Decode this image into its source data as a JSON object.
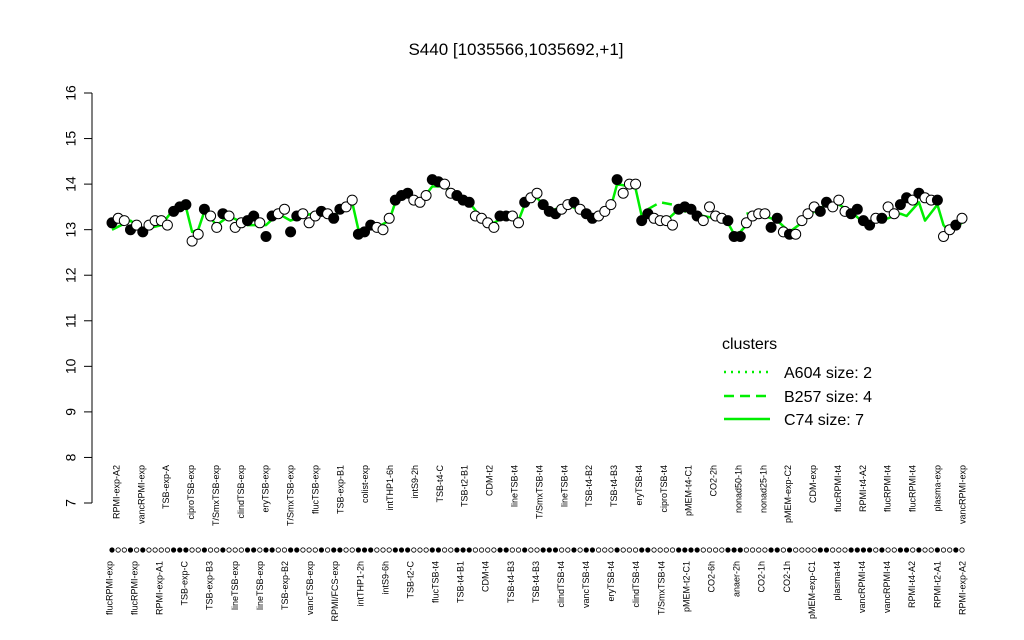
{
  "chart_data": {
    "type": "scatter",
    "title": "S440 [1035566,1035692,+1]",
    "xlabel": "",
    "ylabel": "",
    "ylim": [
      7,
      16
    ],
    "yticks": [
      7,
      8,
      9,
      10,
      11,
      12,
      13,
      14,
      15,
      16
    ],
    "grid": false,
    "line_color": "#00ee00",
    "legend": {
      "title": "clusters",
      "position": "right",
      "entries": [
        {
          "label": "A604 size: 2",
          "style": "dotted"
        },
        {
          "label": "B257 size: 4",
          "style": "dashed"
        },
        {
          "label": "C74 size: 7",
          "style": "solid"
        }
      ]
    },
    "top_labels": [
      "RPMI-exp-A2",
      "vancRPMI-exp",
      "TSB-exp-A",
      "ciproTSB-exp",
      "T/SmxTSB-exp",
      "clindTSB-exp",
      "eryTSB-exp",
      "T/SmxTSB-exp",
      "flucTSB-exp",
      "TSB-exp-B1",
      "colist-exp",
      "intTHP1-6h",
      "intS9-2h",
      "TSB-t4-C",
      "TSB-t2-B1",
      "CDM-t2",
      "lineTSB-t4",
      "T/SmxTSB-t4",
      "lineTSB-t4",
      "TSB-t4-B2",
      "TSB-t4-B3",
      "eryTSB-t4",
      "ciproTSB-t4",
      "pMEM-t4-C1",
      "CO2-2h",
      "nonad50-1h",
      "nonad25-1h",
      "pMEM-exp-C2",
      "CDM-exp",
      "flucRPMI-t4",
      "RPMI-t4-A2",
      "flucRPMI-t4",
      "flucRPMI-t4",
      "plasma-exp",
      "vancRPMI-exp"
    ],
    "bottom_labels": [
      "flucRPMI-exp",
      "flucRPMI-exp",
      "RPMI-exp-A1",
      "TSB-exp-C",
      "TSB-exp-B3",
      "lineTSB-exp",
      "lineTSB-exp",
      "TSB-exp-B2",
      "vancTSB-exp",
      "RPMI/FCS-exp",
      "intTHP1-2h",
      "intS9-6h",
      "TSB-t2-C",
      "flucTSB-t4",
      "TSB-t4-B1",
      "CDM-t4",
      "TSB-t4-B3",
      "TSB-t4-B3",
      "clindTSB-t4",
      "vancTSB-t4",
      "eryTSB-t4",
      "clindTSB-t4",
      "T/SmxTSB-t4",
      "pMEM-t2-C1",
      "CO2-6h",
      "anaer-2h",
      "CO2-1h",
      "CO2-1h",
      "pMEM-exp-C1",
      "plasma-t4",
      "vancRPMI-t4",
      "vancRPMI-t4",
      "RPMI-t4-A2",
      "RPMI-t2-A1",
      "RPMI-exp-A2"
    ],
    "points": [
      {
        "x": 1,
        "y": 13.15,
        "f": 1
      },
      {
        "x": 2,
        "y": 13.25,
        "f": 0
      },
      {
        "x": 3,
        "y": 13.2,
        "f": 0
      },
      {
        "x": 4,
        "y": 13.0,
        "f": 1
      },
      {
        "x": 5,
        "y": 13.1,
        "f": 0
      },
      {
        "x": 6,
        "y": 12.95,
        "f": 1
      },
      {
        "x": 7,
        "y": 13.1,
        "f": 0
      },
      {
        "x": 8,
        "y": 13.2,
        "f": 0
      },
      {
        "x": 9,
        "y": 13.2,
        "f": 0
      },
      {
        "x": 10,
        "y": 13.1,
        "f": 0
      },
      {
        "x": 11,
        "y": 13.4,
        "f": 1
      },
      {
        "x": 12,
        "y": 13.5,
        "f": 1
      },
      {
        "x": 13,
        "y": 13.55,
        "f": 1
      },
      {
        "x": 14,
        "y": 12.75,
        "f": 0
      },
      {
        "x": 15,
        "y": 12.9,
        "f": 0
      },
      {
        "x": 16,
        "y": 13.45,
        "f": 1
      },
      {
        "x": 17,
        "y": 13.3,
        "f": 0
      },
      {
        "x": 18,
        "y": 13.05,
        "f": 0
      },
      {
        "x": 19,
        "y": 13.35,
        "f": 1
      },
      {
        "x": 20,
        "y": 13.3,
        "f": 0
      },
      {
        "x": 21,
        "y": 13.05,
        "f": 0
      },
      {
        "x": 22,
        "y": 13.15,
        "f": 0
      },
      {
        "x": 23,
        "y": 13.2,
        "f": 1
      },
      {
        "x": 24,
        "y": 13.3,
        "f": 1
      },
      {
        "x": 25,
        "y": 13.15,
        "f": 0
      },
      {
        "x": 26,
        "y": 12.85,
        "f": 1
      },
      {
        "x": 27,
        "y": 13.3,
        "f": 1
      },
      {
        "x": 28,
        "y": 13.35,
        "f": 0
      },
      {
        "x": 29,
        "y": 13.45,
        "f": 0
      },
      {
        "x": 30,
        "y": 12.95,
        "f": 1
      },
      {
        "x": 31,
        "y": 13.3,
        "f": 1
      },
      {
        "x": 32,
        "y": 13.35,
        "f": 0
      },
      {
        "x": 33,
        "y": 13.15,
        "f": 0
      },
      {
        "x": 34,
        "y": 13.3,
        "f": 0
      },
      {
        "x": 35,
        "y": 13.4,
        "f": 1
      },
      {
        "x": 36,
        "y": 13.35,
        "f": 0
      },
      {
        "x": 37,
        "y": 13.25,
        "f": 1
      },
      {
        "x": 38,
        "y": 13.45,
        "f": 1
      },
      {
        "x": 39,
        "y": 13.5,
        "f": 0
      },
      {
        "x": 40,
        "y": 13.65,
        "f": 0
      },
      {
        "x": 41,
        "y": 12.9,
        "f": 1
      },
      {
        "x": 42,
        "y": 12.95,
        "f": 1
      },
      {
        "x": 43,
        "y": 13.1,
        "f": 1
      },
      {
        "x": 44,
        "y": 13.05,
        "f": 0
      },
      {
        "x": 45,
        "y": 13.0,
        "f": 0
      },
      {
        "x": 46,
        "y": 13.25,
        "f": 0
      },
      {
        "x": 47,
        "y": 13.65,
        "f": 1
      },
      {
        "x": 48,
        "y": 13.75,
        "f": 1
      },
      {
        "x": 49,
        "y": 13.8,
        "f": 1
      },
      {
        "x": 50,
        "y": 13.65,
        "f": 0
      },
      {
        "x": 51,
        "y": 13.6,
        "f": 0
      },
      {
        "x": 52,
        "y": 13.75,
        "f": 0
      },
      {
        "x": 53,
        "y": 14.1,
        "f": 1
      },
      {
        "x": 54,
        "y": 14.05,
        "f": 1
      },
      {
        "x": 55,
        "y": 14.0,
        "f": 0
      },
      {
        "x": 56,
        "y": 13.8,
        "f": 0
      },
      {
        "x": 57,
        "y": 13.75,
        "f": 1
      },
      {
        "x": 58,
        "y": 13.65,
        "f": 1
      },
      {
        "x": 59,
        "y": 13.6,
        "f": 1
      },
      {
        "x": 60,
        "y": 13.3,
        "f": 0
      },
      {
        "x": 61,
        "y": 13.25,
        "f": 0
      },
      {
        "x": 62,
        "y": 13.15,
        "f": 0
      },
      {
        "x": 63,
        "y": 13.05,
        "f": 0
      },
      {
        "x": 64,
        "y": 13.3,
        "f": 1
      },
      {
        "x": 65,
        "y": 13.3,
        "f": 1
      },
      {
        "x": 66,
        "y": 13.3,
        "f": 0
      },
      {
        "x": 67,
        "y": 13.15,
        "f": 0
      },
      {
        "x": 68,
        "y": 13.6,
        "f": 1
      },
      {
        "x": 69,
        "y": 13.7,
        "f": 0
      },
      {
        "x": 70,
        "y": 13.8,
        "f": 0
      },
      {
        "x": 71,
        "y": 13.55,
        "f": 1
      },
      {
        "x": 72,
        "y": 13.4,
        "f": 1
      },
      {
        "x": 73,
        "y": 13.35,
        "f": 1
      },
      {
        "x": 74,
        "y": 13.45,
        "f": 0
      },
      {
        "x": 75,
        "y": 13.55,
        "f": 0
      },
      {
        "x": 76,
        "y": 13.6,
        "f": 1
      },
      {
        "x": 77,
        "y": 13.45,
        "f": 0
      },
      {
        "x": 78,
        "y": 13.35,
        "f": 1
      },
      {
        "x": 79,
        "y": 13.25,
        "f": 1
      },
      {
        "x": 80,
        "y": 13.3,
        "f": 0
      },
      {
        "x": 81,
        "y": 13.4,
        "f": 0
      },
      {
        "x": 82,
        "y": 13.55,
        "f": 0
      },
      {
        "x": 83,
        "y": 14.1,
        "f": 1
      },
      {
        "x": 84,
        "y": 13.8,
        "f": 0
      },
      {
        "x": 85,
        "y": 14.0,
        "f": 0
      },
      {
        "x": 86,
        "y": 14.0,
        "f": 0
      },
      {
        "x": 87,
        "y": 13.2,
        "f": 1
      },
      {
        "x": 88,
        "y": 13.35,
        "f": 1
      },
      {
        "x": 89,
        "y": 13.25,
        "f": 0
      },
      {
        "x": 90,
        "y": 13.2,
        "f": 0
      },
      {
        "x": 91,
        "y": 13.2,
        "f": 0
      },
      {
        "x": 92,
        "y": 13.1,
        "f": 0
      },
      {
        "x": 93,
        "y": 13.45,
        "f": 1
      },
      {
        "x": 94,
        "y": 13.5,
        "f": 1
      },
      {
        "x": 95,
        "y": 13.45,
        "f": 1
      },
      {
        "x": 96,
        "y": 13.3,
        "f": 1
      },
      {
        "x": 97,
        "y": 13.2,
        "f": 0
      },
      {
        "x": 98,
        "y": 13.5,
        "f": 0
      },
      {
        "x": 99,
        "y": 13.3,
        "f": 0
      },
      {
        "x": 100,
        "y": 13.25,
        "f": 0
      },
      {
        "x": 101,
        "y": 13.2,
        "f": 1
      },
      {
        "x": 102,
        "y": 12.85,
        "f": 1
      },
      {
        "x": 103,
        "y": 12.85,
        "f": 1
      },
      {
        "x": 104,
        "y": 13.15,
        "f": 0
      },
      {
        "x": 105,
        "y": 13.3,
        "f": 0
      },
      {
        "x": 106,
        "y": 13.35,
        "f": 0
      },
      {
        "x": 107,
        "y": 13.35,
        "f": 0
      },
      {
        "x": 108,
        "y": 13.05,
        "f": 1
      },
      {
        "x": 109,
        "y": 13.25,
        "f": 1
      },
      {
        "x": 110,
        "y": 12.95,
        "f": 0
      },
      {
        "x": 111,
        "y": 12.9,
        "f": 1
      },
      {
        "x": 112,
        "y": 12.9,
        "f": 0
      },
      {
        "x": 113,
        "y": 13.2,
        "f": 0
      },
      {
        "x": 114,
        "y": 13.35,
        "f": 0
      },
      {
        "x": 115,
        "y": 13.5,
        "f": 0
      },
      {
        "x": 116,
        "y": 13.4,
        "f": 1
      },
      {
        "x": 117,
        "y": 13.6,
        "f": 1
      },
      {
        "x": 118,
        "y": 13.5,
        "f": 0
      },
      {
        "x": 119,
        "y": 13.65,
        "f": 0
      },
      {
        "x": 120,
        "y": 13.4,
        "f": 0
      },
      {
        "x": 121,
        "y": 13.35,
        "f": 1
      },
      {
        "x": 122,
        "y": 13.45,
        "f": 1
      },
      {
        "x": 123,
        "y": 13.2,
        "f": 1
      },
      {
        "x": 124,
        "y": 13.1,
        "f": 1
      },
      {
        "x": 125,
        "y": 13.25,
        "f": 0
      },
      {
        "x": 126,
        "y": 13.25,
        "f": 1
      },
      {
        "x": 127,
        "y": 13.5,
        "f": 0
      },
      {
        "x": 128,
        "y": 13.35,
        "f": 0
      },
      {
        "x": 129,
        "y": 13.55,
        "f": 1
      },
      {
        "x": 130,
        "y": 13.7,
        "f": 1
      },
      {
        "x": 131,
        "y": 13.65,
        "f": 0
      },
      {
        "x": 132,
        "y": 13.8,
        "f": 1
      },
      {
        "x": 133,
        "y": 13.7,
        "f": 0
      },
      {
        "x": 134,
        "y": 13.65,
        "f": 0
      },
      {
        "x": 135,
        "y": 13.65,
        "f": 1
      },
      {
        "x": 136,
        "y": 12.85,
        "f": 0
      },
      {
        "x": 137,
        "y": 13.0,
        "f": 0
      },
      {
        "x": 138,
        "y": 13.1,
        "f": 1
      },
      {
        "x": 139,
        "y": 13.25,
        "f": 0
      }
    ],
    "line_solid": [
      [
        1,
        13.0
      ],
      [
        4,
        13.2
      ],
      [
        6,
        13.0
      ],
      [
        9,
        13.1
      ],
      [
        11,
        13.45
      ],
      [
        13,
        13.5
      ],
      [
        14,
        12.95
      ],
      [
        15,
        13.0
      ],
      [
        16,
        13.4
      ],
      [
        18,
        13.1
      ],
      [
        20,
        13.3
      ],
      [
        23,
        13.1
      ],
      [
        26,
        13.1
      ],
      [
        28,
        13.35
      ],
      [
        30,
        13.2
      ],
      [
        32,
        13.3
      ],
      [
        35,
        13.4
      ],
      [
        37,
        13.3
      ],
      [
        40,
        13.6
      ],
      [
        41,
        13.0
      ],
      [
        44,
        13.05
      ],
      [
        46,
        13.2
      ],
      [
        47,
        13.6
      ],
      [
        49,
        13.75
      ],
      [
        51,
        13.6
      ],
      [
        53,
        13.95
      ],
      [
        55,
        13.95
      ],
      [
        57,
        13.7
      ],
      [
        59,
        13.6
      ],
      [
        61,
        13.25
      ],
      [
        63,
        13.15
      ],
      [
        65,
        13.3
      ],
      [
        67,
        13.2
      ],
      [
        68,
        13.55
      ],
      [
        70,
        13.7
      ],
      [
        72,
        13.4
      ],
      [
        75,
        13.55
      ],
      [
        78,
        13.35
      ],
      [
        80,
        13.3
      ],
      [
        82,
        13.5
      ],
      [
        83,
        14.0
      ],
      [
        85,
        13.95
      ],
      [
        86,
        13.9
      ],
      [
        87,
        13.3
      ],
      [
        89,
        13.25
      ],
      [
        91,
        13.2
      ],
      [
        93,
        13.45
      ],
      [
        95,
        13.4
      ],
      [
        97,
        13.3
      ],
      [
        99,
        13.25
      ],
      [
        101,
        13.15
      ],
      [
        102,
        12.9
      ],
      [
        103,
        12.95
      ],
      [
        105,
        13.25
      ],
      [
        107,
        13.3
      ],
      [
        109,
        13.2
      ],
      [
        111,
        12.95
      ],
      [
        113,
        13.15
      ],
      [
        115,
        13.4
      ],
      [
        117,
        13.55
      ],
      [
        119,
        13.55
      ],
      [
        121,
        13.4
      ],
      [
        123,
        13.15
      ],
      [
        125,
        13.2
      ],
      [
        127,
        13.25
      ],
      [
        129,
        13.35
      ],
      [
        130,
        13.3
      ],
      [
        132,
        13.6
      ],
      [
        133,
        13.2
      ],
      [
        135,
        13.55
      ],
      [
        136,
        13.1
      ],
      [
        137,
        12.95
      ],
      [
        138,
        13.05
      ],
      [
        139,
        13.15
      ]
    ],
    "line_dashed": [
      [
        88,
        13.45
      ],
      [
        90,
        13.6
      ],
      [
        92,
        13.55
      ],
      [
        94,
        13.4
      ],
      [
        96,
        13.35
      ]
    ],
    "line_dotted": [
      [
        104,
        13.35
      ],
      [
        106,
        13.4
      ],
      [
        108,
        13.3
      ]
    ]
  }
}
